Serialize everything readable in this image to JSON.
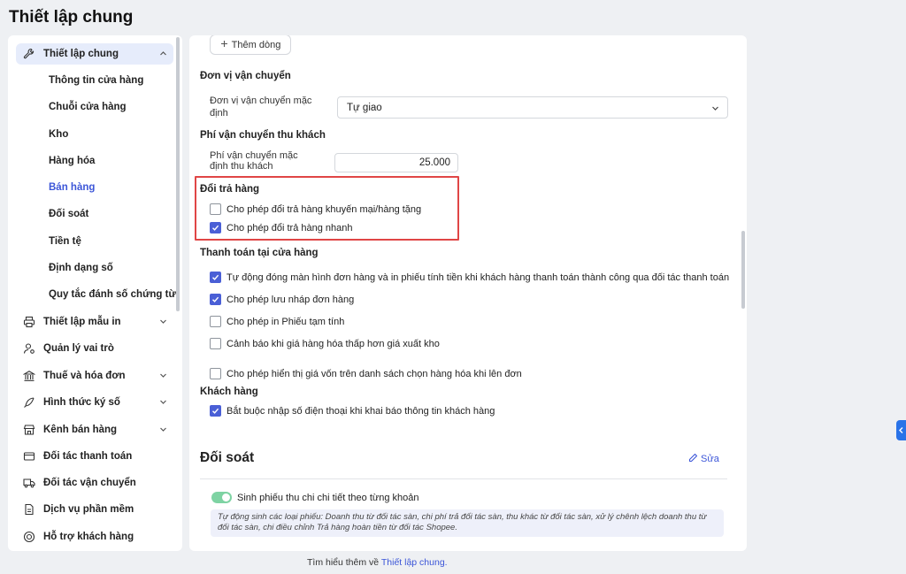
{
  "page_title": "Thiết lập chung",
  "sidebar": {
    "general": {
      "label": "Thiết lập chung",
      "icon": "wrench-icon"
    },
    "sub_items": [
      {
        "label": "Thông tin cửa hàng"
      },
      {
        "label": "Chuỗi cửa hàng"
      },
      {
        "label": "Kho"
      },
      {
        "label": "Hàng hóa"
      },
      {
        "label": "Bán hàng"
      },
      {
        "label": "Đối soát"
      },
      {
        "label": "Tiền tệ"
      },
      {
        "label": "Định dạng số"
      },
      {
        "label": "Quy tắc đánh số chứng từ"
      }
    ],
    "items": [
      {
        "label": "Thiết lập mẫu in",
        "icon": "printer-icon",
        "expandable": true
      },
      {
        "label": "Quản lý vai trò",
        "icon": "user-role-icon",
        "expandable": false
      },
      {
        "label": "Thuế và hóa đơn",
        "icon": "bank-icon",
        "expandable": true
      },
      {
        "label": "Hình thức ký số",
        "icon": "pen-nib-icon",
        "expandable": true
      },
      {
        "label": "Kênh bán hàng",
        "icon": "store-icon",
        "expandable": true
      },
      {
        "label": "Đối tác thanh toán",
        "icon": "payment-card-icon",
        "expandable": false
      },
      {
        "label": "Đối tác vận chuyển",
        "icon": "truck-icon",
        "expandable": false
      },
      {
        "label": "Dịch vụ phần mềm",
        "icon": "document-icon",
        "expandable": false
      },
      {
        "label": "Hỗ trợ khách hàng",
        "icon": "support-icon",
        "expandable": false
      }
    ]
  },
  "main": {
    "add_row_label": "Thêm dòng",
    "shipping": {
      "title": "Đơn vị vận chuyển",
      "default_label": "Đơn vị vận chuyển mặc định",
      "default_value": "Tự giao"
    },
    "shipping_fee": {
      "title": "Phí vận chuyển thu khách",
      "default_label": "Phí vận chuyển mặc định thu khách",
      "default_value": "25.000"
    },
    "returns": {
      "title": "Đổi trả hàng",
      "options": [
        {
          "label": "Cho phép đổi trả hàng khuyến mại/hàng tặng",
          "checked": false
        },
        {
          "label": "Cho phép đổi trả hàng nhanh",
          "checked": true
        }
      ]
    },
    "store_payment": {
      "title": "Thanh toán tại cửa hàng",
      "options": [
        {
          "label": "Tự động đóng màn hình đơn hàng và in phiếu tính tiền khi khách hàng thanh toán thành công qua đối tác thanh toán",
          "checked": true
        },
        {
          "label": "Cho phép lưu nháp đơn hàng",
          "checked": true
        },
        {
          "label": "Cho phép in Phiếu tạm tính",
          "checked": false
        },
        {
          "label": "Cảnh báo khi giá hàng hóa thấp hơn giá xuất kho",
          "checked": false
        },
        {
          "label": "Cho phép hiển thị giá vốn trên danh sách chọn hàng hóa khi lên đơn",
          "checked": false
        }
      ]
    },
    "customer": {
      "title": "Khách hàng",
      "options": [
        {
          "label": "Bắt buộc nhập số điện thoại khi khai báo thông tin khách hàng",
          "checked": true
        }
      ]
    },
    "reconciliation": {
      "title": "Đối soát",
      "edit_label": "Sửa",
      "toggle_label": "Sinh phiếu thu chi chi tiết theo từng khoản",
      "toggle_on": true,
      "note": "Tự động sinh các loại phiếu: Doanh thu từ đối tác sàn, chi phí trả đối tác sàn, thu khác từ đối tác sàn, xử lý chênh lệch doanh thu từ đối tác sàn, chi điều chỉnh Trả hàng hoàn tiền từ đối tác Shopee."
    }
  },
  "footer": {
    "prefix": "Tìm hiểu thêm về",
    "link": "Thiết lập chung."
  },
  "colors": {
    "accent": "#3c56d8",
    "checkbox_on": "#4a5fd6",
    "highlight_border": "#e04646",
    "toggle_on": "#7ed3a3"
  }
}
